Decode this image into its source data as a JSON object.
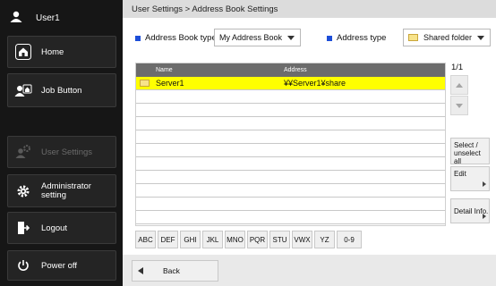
{
  "sidebar": {
    "user_label": "User1",
    "items": [
      {
        "label": "Home",
        "icon": "home-icon"
      },
      {
        "label": "Job Button",
        "icon": "job-button-icon"
      },
      {
        "label": "User Settings",
        "icon": "user-settings-icon",
        "disabled": true
      },
      {
        "label_line1": "Administrator",
        "label_line2": "setting",
        "icon": "gear-icon"
      },
      {
        "label": "Logout",
        "icon": "logout-icon"
      },
      {
        "label": "Power off",
        "icon": "power-icon"
      }
    ]
  },
  "breadcrumb": "User Settings > Address Book Settings",
  "toolbar": {
    "address_book_type_label": "Address Book type",
    "address_book_type_value": "My Address Book",
    "address_type_label": "Address type",
    "address_type_value": "Shared folder"
  },
  "list": {
    "columns": [
      "Name",
      "Address"
    ],
    "rows": [
      {
        "name": "Server1",
        "address": "¥¥Server1¥share",
        "selected": true
      }
    ],
    "empty_rows": 10
  },
  "pager": "1/1",
  "side_buttons": {
    "select_line1": "Select /",
    "select_line2": "unselect all",
    "edit": "Edit",
    "detail": "Detail Info."
  },
  "alpha_tabs": [
    "ABC",
    "DEF",
    "GHI",
    "JKL",
    "MNO",
    "PQR",
    "STU",
    "VWX",
    "YZ",
    "0-9"
  ],
  "back_label": "Back",
  "colors": {
    "accent": "#1d4ed8",
    "selection": "#ffff00"
  }
}
